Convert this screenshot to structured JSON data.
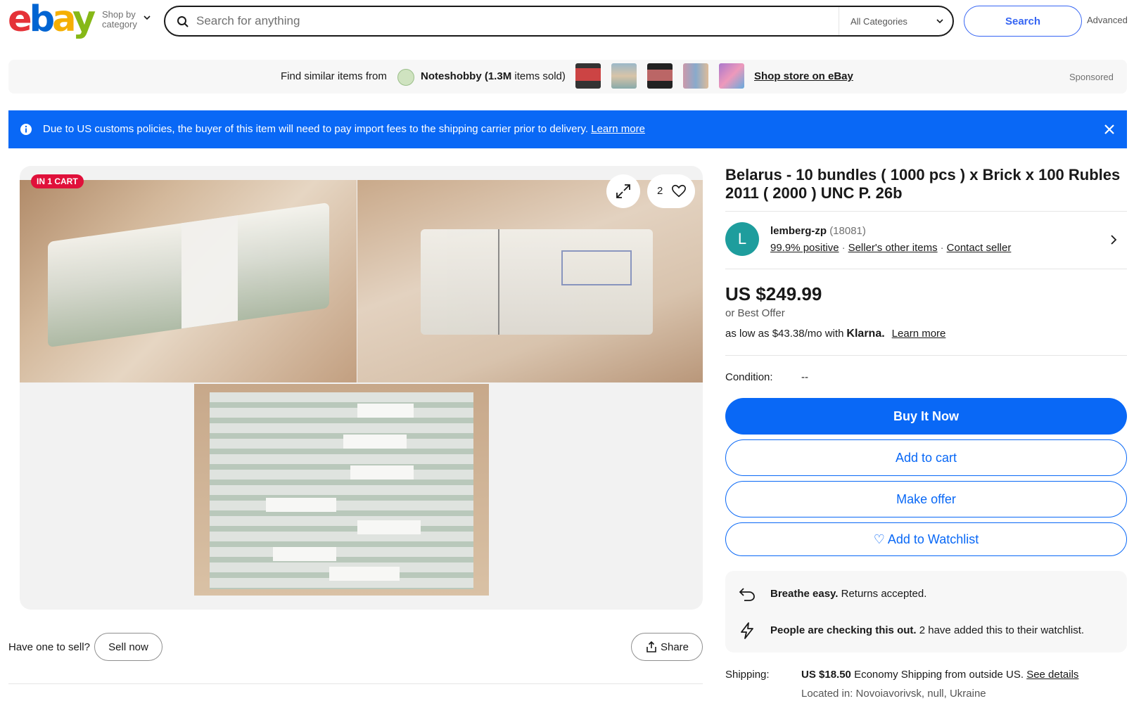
{
  "header": {
    "logo_letters": [
      "e",
      "b",
      "a",
      "y"
    ],
    "shop_by_line1": "Shop by",
    "shop_by_line2": "category",
    "search_placeholder": "Search for anything",
    "category_select": "All Categories",
    "search_button": "Search",
    "advanced": "Advanced"
  },
  "store_banner": {
    "find_text": "Find similar items from",
    "store_name": "Noteshobby",
    "sold_count": "(1.3M",
    "sold_suffix": "items sold)",
    "shop_link": "Shop store on eBay",
    "sponsored": "Sponsored"
  },
  "notice": {
    "message": "Due to US customs policies, the buyer of this item will need to pay import fees to the shipping carrier prior to delivery.",
    "link": "Learn more"
  },
  "gallery": {
    "badge": "IN 1 CART",
    "watch_count": "2"
  },
  "sell": {
    "question": "Have one to sell?",
    "sell_now": "Sell now",
    "share": "Share"
  },
  "listing": {
    "title": "Belarus - 10 bundles ( 1000 pcs ) x Brick x 100 Rubles 2011 ( 2000 ) UNC P. 26b",
    "seller_initial": "L",
    "seller_name": "lemberg-zp",
    "seller_feedback": "(18081)",
    "positive": "99.9% positive",
    "other_items": "Seller's other items",
    "contact": "Contact seller",
    "price": "US $249.99",
    "best_offer": "or Best Offer",
    "klarna_prefix": "as low as $43.38/mo with",
    "klarna_brand": "Klarna.",
    "klarna_link": "Learn more",
    "condition_label": "Condition:",
    "condition_value": "--",
    "buy_now": "Buy It Now",
    "add_to_cart": "Add to cart",
    "make_offer": "Make offer",
    "add_watchlist": "♡ Add to Watchlist",
    "returns_bold": "Breathe easy.",
    "returns_text": "Returns accepted.",
    "checking_bold": "People are checking this out.",
    "checking_text": "2 have added this to their watchlist.",
    "shipping_label": "Shipping:",
    "shipping_price": "US $18.50",
    "shipping_text": "Economy Shipping from outside US.",
    "shipping_link": "See details",
    "located": "Located in: Novoiavorivsk, null, Ukraine"
  },
  "colors": {
    "primary_blue": "#0968f6",
    "cart_badge_red": "#e0103a",
    "seller_avatar_teal": "#1e9d9d"
  }
}
